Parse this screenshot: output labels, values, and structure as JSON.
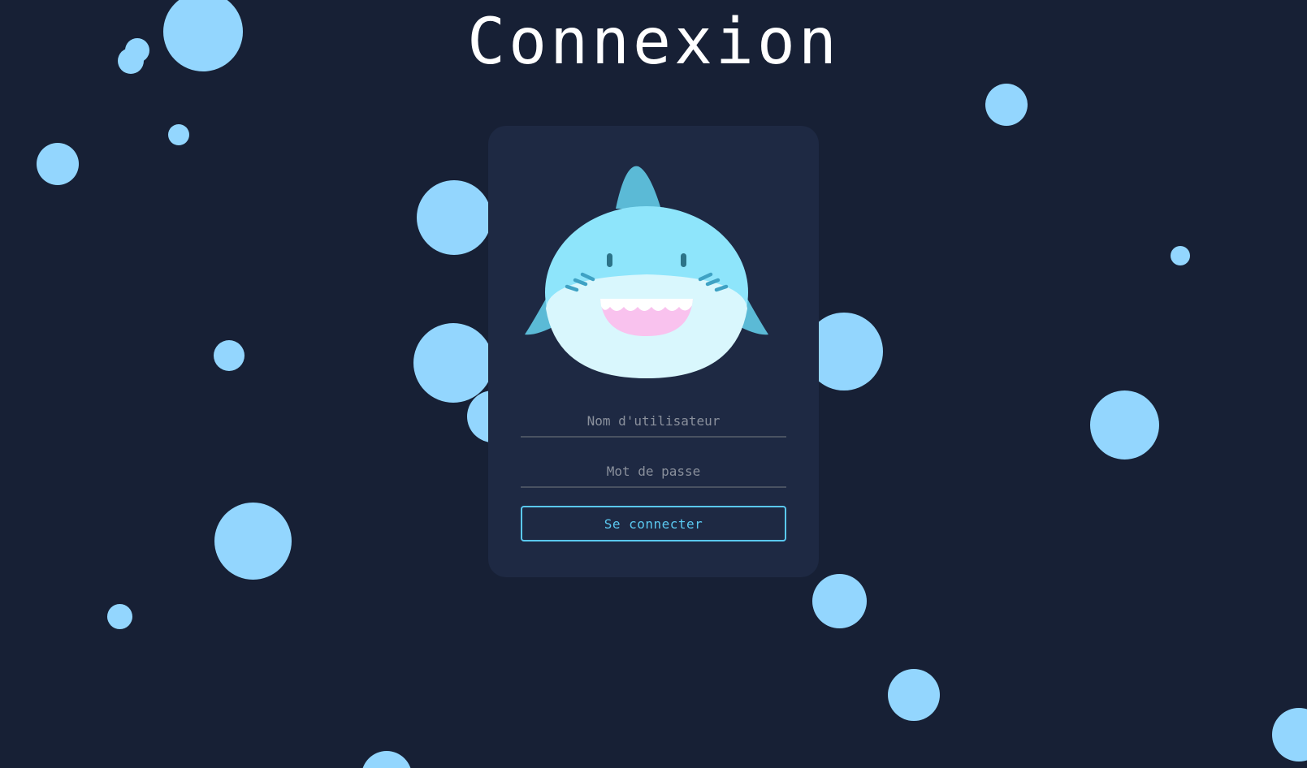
{
  "page": {
    "title": "Connexion"
  },
  "login": {
    "username_placeholder": "Nom d'utilisateur",
    "username_value": "",
    "password_placeholder": "Mot de passe",
    "password_value": "",
    "submit_label": "Se connecter"
  },
  "colors": {
    "background": "#172035",
    "card": "#1e2943",
    "bubble": "#93d6fe",
    "accent": "#5ac8f0",
    "title": "#ffffff"
  },
  "icons": {
    "mascot": "shark-icon"
  }
}
